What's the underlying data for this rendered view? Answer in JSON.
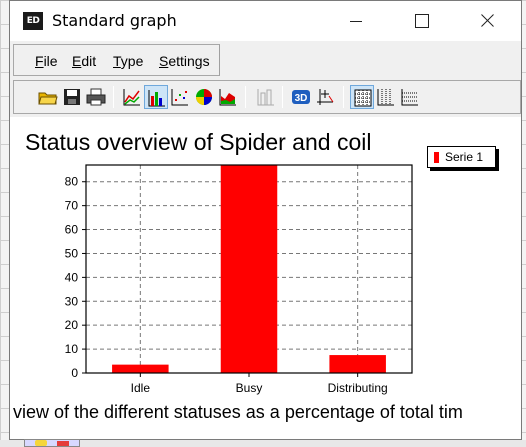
{
  "window": {
    "title": "Standard graph",
    "icon_text": "ED"
  },
  "menu": {
    "items": [
      "File",
      "Edit",
      "Type",
      "Settings"
    ]
  },
  "toolbar": {
    "buttons": [
      "open-folder-icon",
      "save-icon",
      "print-icon",
      "area-chart-icon",
      "bar-chart-icon",
      "scatter-chart-icon",
      "pie-chart-icon",
      "mountain-chart-icon",
      "stacked-chart-icon",
      "3d-icon",
      "axis-icon",
      "grid-box-icon",
      "grid-vertical-icon",
      "grid-horizontal-icon"
    ],
    "active": "bar-chart-icon",
    "three_d_label": "3D"
  },
  "chart_data": {
    "type": "bar",
    "title": "Status overview of Spider and coil",
    "subtitle": "view of the different statuses as a percentage of total tim",
    "categories": [
      "Idle",
      "Busy",
      "Distributing"
    ],
    "series": [
      {
        "name": "Serie 1",
        "values": [
          3.5,
          87,
          7.5
        ],
        "color": "#ff0000"
      }
    ],
    "ylim": [
      0,
      87
    ],
    "yticks": [
      0,
      10,
      20,
      30,
      40,
      50,
      60,
      70,
      80
    ],
    "grid": true,
    "legend": "top-right"
  }
}
